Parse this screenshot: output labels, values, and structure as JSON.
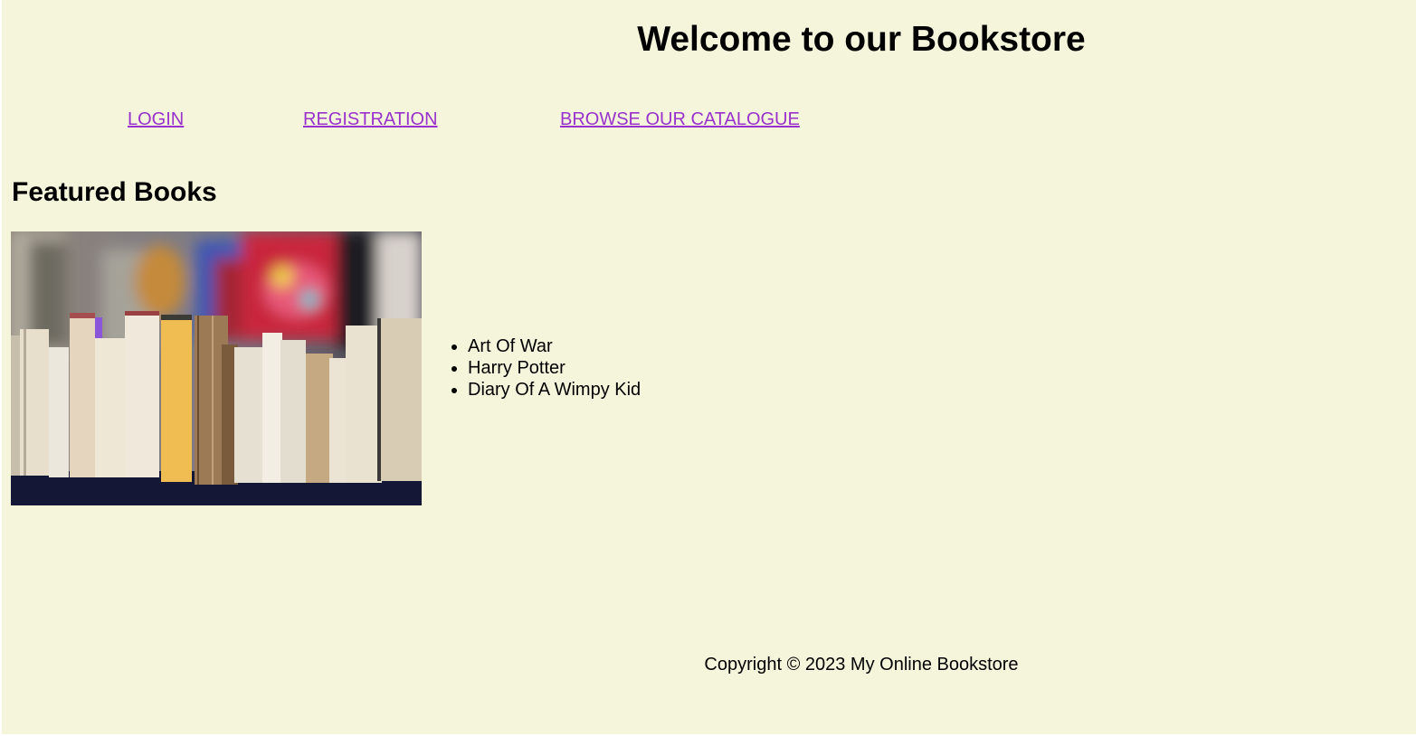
{
  "header": {
    "title": "Welcome to our Bookstore"
  },
  "nav": {
    "items": [
      {
        "label": "LOGIN"
      },
      {
        "label": "REGISTRATION"
      },
      {
        "label": "BROWSE OUR CATALOGUE"
      }
    ]
  },
  "featured": {
    "heading": "Featured Books",
    "image_subject": "row-of-old-books-photo",
    "books": [
      "Art Of War",
      "Harry Potter",
      "Diary Of A Wimpy Kid"
    ]
  },
  "footer": {
    "copyright": "Copyright © 2023 My Online Bookstore"
  },
  "colors": {
    "page_background": "#f5f5dc",
    "link": "#9932cc",
    "text": "#000000"
  }
}
